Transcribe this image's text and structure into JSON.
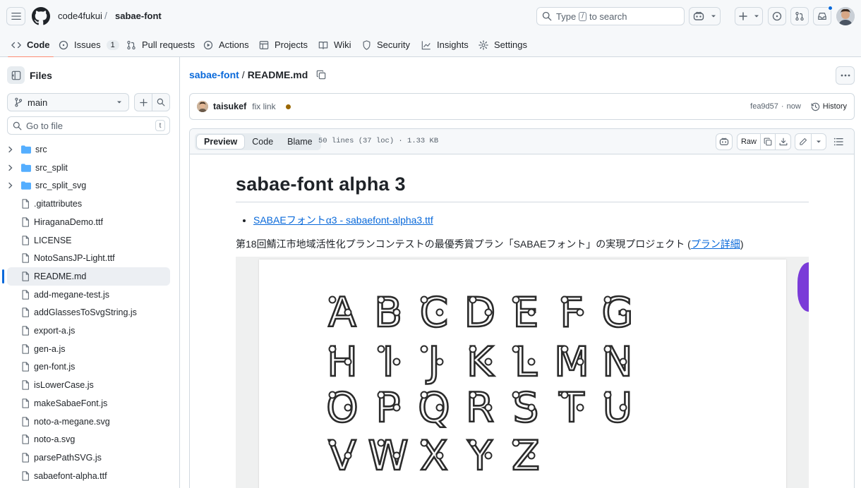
{
  "header": {
    "owner": "code4fukui",
    "repo": "sabae-font",
    "search_text": "Type",
    "search_key": "/",
    "search_suffix": "to search"
  },
  "repo_tabs": [
    {
      "label": "Code",
      "icon": "code-icon"
    },
    {
      "label": "Issues",
      "icon": "issue-icon",
      "count": "1"
    },
    {
      "label": "Pull requests",
      "icon": "pull-request-icon"
    },
    {
      "label": "Actions",
      "icon": "play-icon"
    },
    {
      "label": "Projects",
      "icon": "table-icon"
    },
    {
      "label": "Wiki",
      "icon": "book-icon"
    },
    {
      "label": "Security",
      "icon": "shield-icon"
    },
    {
      "label": "Insights",
      "icon": "graph-icon"
    },
    {
      "label": "Settings",
      "icon": "gear-icon"
    }
  ],
  "sidebar": {
    "title": "Files",
    "branch": "main",
    "goto_placeholder": "Go to file",
    "goto_key": "t",
    "items": [
      {
        "name": "src",
        "type": "dir"
      },
      {
        "name": "src_split",
        "type": "dir"
      },
      {
        "name": "src_split_svg",
        "type": "dir"
      },
      {
        "name": ".gitattributes",
        "type": "file"
      },
      {
        "name": "HiraganaDemo.ttf",
        "type": "file"
      },
      {
        "name": "LICENSE",
        "type": "file"
      },
      {
        "name": "NotoSansJP-Light.ttf",
        "type": "file"
      },
      {
        "name": "README.md",
        "type": "file",
        "selected": true
      },
      {
        "name": "add-megane-test.js",
        "type": "file"
      },
      {
        "name": "addGlassesToSvgString.js",
        "type": "file"
      },
      {
        "name": "export-a.js",
        "type": "file"
      },
      {
        "name": "gen-a.js",
        "type": "file"
      },
      {
        "name": "gen-font.js",
        "type": "file"
      },
      {
        "name": "isLowerCase.js",
        "type": "file"
      },
      {
        "name": "makeSabaeFont.js",
        "type": "file"
      },
      {
        "name": "noto-a-megane.svg",
        "type": "file"
      },
      {
        "name": "noto-a.svg",
        "type": "file"
      },
      {
        "name": "parsePathSVG.js",
        "type": "file"
      },
      {
        "name": "sabaefont-alpha.ttf",
        "type": "file"
      }
    ]
  },
  "breadcrumb": {
    "repo": "sabae-font",
    "sep": "/",
    "file": "README.md"
  },
  "commit": {
    "author": "taisukef",
    "message": "fix link",
    "sha": "fea9d57",
    "sep": "·",
    "time": "now",
    "history": "History"
  },
  "file_header": {
    "tabs": [
      "Preview",
      "Code",
      "Blame"
    ],
    "active_tab": "Preview",
    "meta": "50 lines (37 loc) · 1.33 KB",
    "raw": "Raw"
  },
  "readme": {
    "title": "sabae-font alpha 3",
    "bullet_link": "SABAEフォントα3 - sabaefont-alpha3.ttf",
    "para_text": "第18回鯖江市地域活性化プランコンテストの最優秀賞プラン「SABAEフォント」の実現プロジェクト (",
    "para_link": "プラン詳細",
    "para_end": ")"
  },
  "sample_letters": [
    [
      "A",
      "B",
      "C",
      "D",
      "E",
      "F",
      "G"
    ],
    [
      "H",
      "I",
      "J",
      "K",
      "L",
      "M",
      "N"
    ],
    [
      "O",
      "P",
      "Q",
      "R",
      "S",
      "T",
      "U"
    ],
    [
      "V",
      "W",
      "X",
      "Y",
      "Z"
    ]
  ],
  "colors": {
    "accent": "#0969da",
    "tab_underline": "#fd8c73",
    "status_dot": "#9a6700",
    "folder": "#54aeff"
  }
}
